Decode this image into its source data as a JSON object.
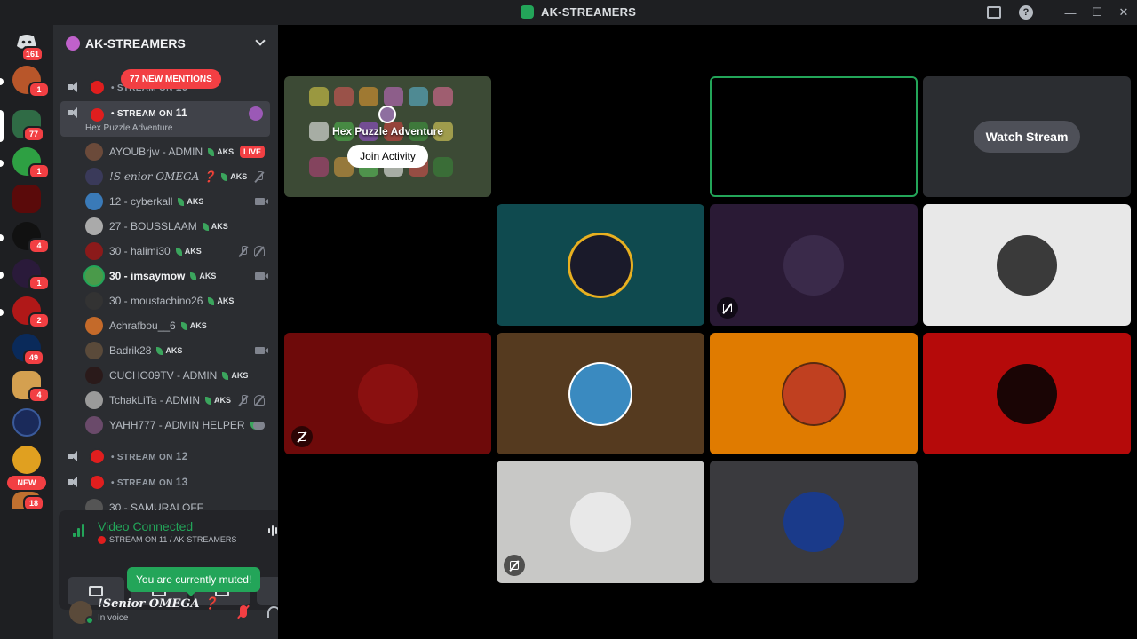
{
  "window": {
    "title": "AK-STREAMERS"
  },
  "rail": {
    "home_badge": "161",
    "servers": [
      {
        "badge": "1"
      },
      {
        "badge": "77"
      },
      {
        "badge": "1"
      },
      {
        "badge": ""
      },
      {
        "badge": "4"
      },
      {
        "badge": "1"
      },
      {
        "badge": "2"
      },
      {
        "badge": "49"
      },
      {
        "badge": "4"
      },
      {
        "badge": ""
      },
      {
        "badge": "18"
      }
    ],
    "new_label": "NEW"
  },
  "sidebar": {
    "guild_name": "AK-STREAMERS",
    "mentions_pill": "77 NEW MENTIONS",
    "channels": {
      "stream10": {
        "prefix": "STREAM ON",
        "num": "10"
      },
      "stream11": {
        "prefix": "STREAM ON",
        "num": "11",
        "activity": "Hex Puzzle Adventure"
      },
      "stream12": {
        "prefix": "STREAM ON",
        "num": "12"
      },
      "stream13": {
        "prefix": "STREAM ON",
        "num": "13"
      }
    },
    "users": [
      {
        "name": "AYOUBrjw - ADMIN",
        "tag": "AKS",
        "status": "LIVE",
        "color": "#6b4a3a"
      },
      {
        "name": "!S enior OMEGA ❓",
        "tag": "AKS",
        "color": "#3a3a5a"
      },
      {
        "name": "12 - cyberkall",
        "tag": "AKS",
        "color": "#3a7ab8"
      },
      {
        "name": "27 - BOUSSLAAM",
        "tag": "AKS",
        "color": "#aaaaaa"
      },
      {
        "name": "30 - halimi30",
        "tag": "AKS",
        "color": "#8b1a1a"
      },
      {
        "name": "30 - imsaymow",
        "tag": "AKS",
        "color": "#4a9a4a"
      },
      {
        "name": "30 - moustachino26",
        "tag": "AKS",
        "color": "#333333"
      },
      {
        "name": "Achrafbou__6",
        "tag": "AKS",
        "color": "#c46a2a"
      },
      {
        "name": "Badrik28",
        "tag": "AKS",
        "color": "#5a4a3a"
      },
      {
        "name": "CUCHO09TV - ADMIN",
        "tag": "AKS",
        "color": "#2a1a1a"
      },
      {
        "name": "TchakLiTa - ADMIN",
        "tag": "AKS",
        "color": "#9a9a9a"
      },
      {
        "name": "YAHH777 - ADMIN HELPER",
        "tag": "",
        "color": "#6a4a6a"
      }
    ],
    "overflow_user": "30 - SAMURAI OFF"
  },
  "voice": {
    "title": "Video Connected",
    "channel": "STREAM ON 11 / AK-STREAMERS",
    "tooltip": "You are currently muted!"
  },
  "user_panel": {
    "name": "!Senior OMEGA ❓",
    "status": "In voice"
  },
  "stage": {
    "activity_title": "Hex Puzzle Adventure",
    "join_label": "Join Activity",
    "watch_label": "Watch Stream"
  },
  "colors": {
    "accent_green": "#23a559",
    "danger_red": "#f23f43",
    "sidebar_bg": "#2b2d31",
    "rail_bg": "#1e1f22"
  }
}
